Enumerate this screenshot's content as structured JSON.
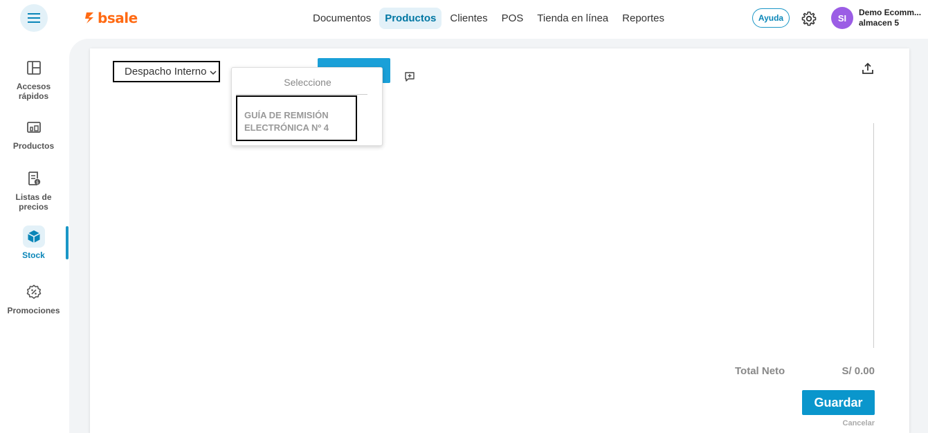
{
  "brand": {
    "name": "bsale",
    "color": "#ff6a13"
  },
  "nav": {
    "items": [
      {
        "label": "Documentos"
      },
      {
        "label": "Productos",
        "active": true
      },
      {
        "label": "Clientes"
      },
      {
        "label": "POS"
      },
      {
        "label": "Tienda en línea"
      },
      {
        "label": "Reportes"
      }
    ]
  },
  "header": {
    "help_label": "Ayuda",
    "avatar_initials": "SI",
    "user_name": "Demo Ecomm...",
    "user_store": "almacen 5"
  },
  "sidebar": {
    "items": [
      {
        "label": "Accesos rápidos",
        "icon": "dashboard-icon"
      },
      {
        "label": "Productos",
        "icon": "products-icon"
      },
      {
        "label": "Listas de precios",
        "icon": "price-list-icon"
      },
      {
        "label": "Stock",
        "icon": "box-icon",
        "active": true
      },
      {
        "label": "Promociones",
        "icon": "discount-icon"
      }
    ]
  },
  "form": {
    "document_type": "Despacho Interno"
  },
  "dropdown": {
    "header": "Seleccione",
    "option": "GUÍA DE REMISIÓN ELECTRÓNICA Nº 4"
  },
  "totals": {
    "label": "Total Neto",
    "value": "S/ 0.00"
  },
  "actions": {
    "save_label": "Guardar",
    "cancel_label": "Cancelar"
  },
  "colors": {
    "accent": "#1a96c6",
    "save_button": "#0a96cc",
    "avatar": "#9b5de5"
  }
}
